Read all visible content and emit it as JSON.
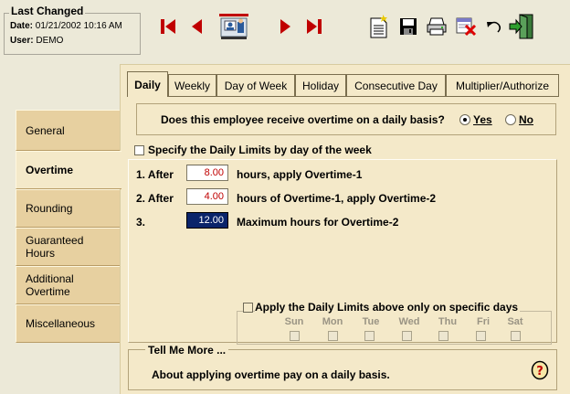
{
  "last_changed": {
    "title": "Last Changed",
    "date_label": "Date:",
    "date_value": "01/21/2002 10:16 AM",
    "user_label": "User:",
    "user_value": "DEMO"
  },
  "toolbar": {
    "buttons": [
      "first-record",
      "previous-record",
      "employee-lookup",
      "next-record",
      "last-record",
      "new-record",
      "save",
      "print",
      "delete",
      "undo",
      "exit"
    ]
  },
  "nav": {
    "items": [
      {
        "label": "General"
      },
      {
        "label": "Overtime"
      },
      {
        "label": "Rounding"
      },
      {
        "label": "Guaranteed Hours"
      },
      {
        "label": "Additional Overtime"
      },
      {
        "label": "Miscellaneous"
      }
    ],
    "active": "Overtime"
  },
  "tabs": {
    "items": [
      "Daily",
      "Weekly",
      "Day of Week",
      "Holiday",
      "Consecutive Day",
      "Multiplier/Authorize"
    ],
    "active": "Daily"
  },
  "question": {
    "text": "Does this employee receive overtime on a daily basis?",
    "yes": "Yes",
    "no": "No",
    "selected": "Yes"
  },
  "specify_daily": {
    "label": "Specify the Daily Limits by day of the week",
    "checked": false
  },
  "limits": [
    {
      "num": "1. After",
      "value": "8.00",
      "text": "hours, apply Overtime-1"
    },
    {
      "num": "2. After",
      "value": "4.00",
      "text": "hours of Overtime-1, apply Overtime-2"
    },
    {
      "num": "3.",
      "value": "12.00",
      "text": "Maximum hours for Overtime-2"
    }
  ],
  "specific_days": {
    "label": "Apply the Daily Limits above only on specific days",
    "days": [
      "Sun",
      "Mon",
      "Tue",
      "Wed",
      "Thu",
      "Fri",
      "Sat"
    ]
  },
  "tell_me_more": {
    "title": "Tell Me More ...",
    "text": "About applying overtime pay on a daily basis."
  }
}
